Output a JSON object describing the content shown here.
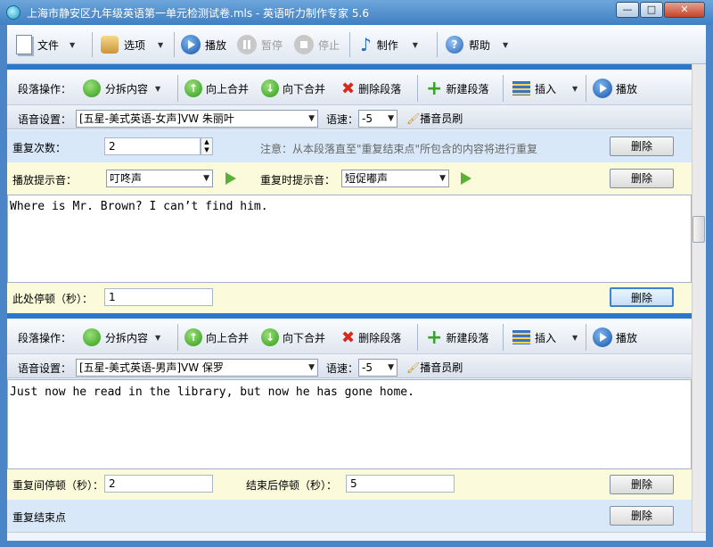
{
  "window": {
    "title": "上海市静安区九年级英语第一单元检测试卷.mls - 英语听力制作专家 5.6",
    "min": "—",
    "max": "□",
    "close": "✕"
  },
  "menu": {
    "file": "文件",
    "options": "选项",
    "play": "播放",
    "pause": "暂停",
    "stop": "停止",
    "make": "制作",
    "help": "帮助"
  },
  "para_toolbar": {
    "op_label": "段落操作：",
    "split": "分拆内容",
    "merge_up": "向上合并",
    "merge_down": "向下合并",
    "delete_para": "删除段落",
    "new_para": "新建段落",
    "insert": "插入",
    "play": "播放"
  },
  "voice": {
    "label": "语音设置：",
    "speed_label": "语速：",
    "speed_value": "-5",
    "announcer": "播音员刷"
  },
  "block_repeat": {
    "count_label": "重复次数：",
    "count_value": "2",
    "note": "注意：从本段落直至\"重复结束点\"所包含的内容将进行重复",
    "delete": "删除",
    "play_tone_label": "播放提示音：",
    "play_tone_value": "叮咚声",
    "repeat_tone_label": "重复时提示音：",
    "repeat_tone_value": "短促嘟声",
    "delete2": "删除"
  },
  "para1": {
    "voice_value": "[五星-美式英语-女声]VW 朱丽叶",
    "text": "Where is Mr. Brown? I can’t find him.",
    "pause_label": "此处停顿（秒）：",
    "pause_value": "1",
    "delete": "删除"
  },
  "para2": {
    "voice_value": "[五星-美式英语-男声]VW 保罗",
    "text": "Just now he read in the library, but now he has gone home.",
    "repeat_pause_label": "重复间停顿（秒）：",
    "repeat_pause_value": "2",
    "end_pause_label": "结束后停顿（秒）：",
    "end_pause_value": "5",
    "delete": "删除"
  },
  "repeat_end": {
    "label": "重复结束点",
    "delete": "删除"
  }
}
